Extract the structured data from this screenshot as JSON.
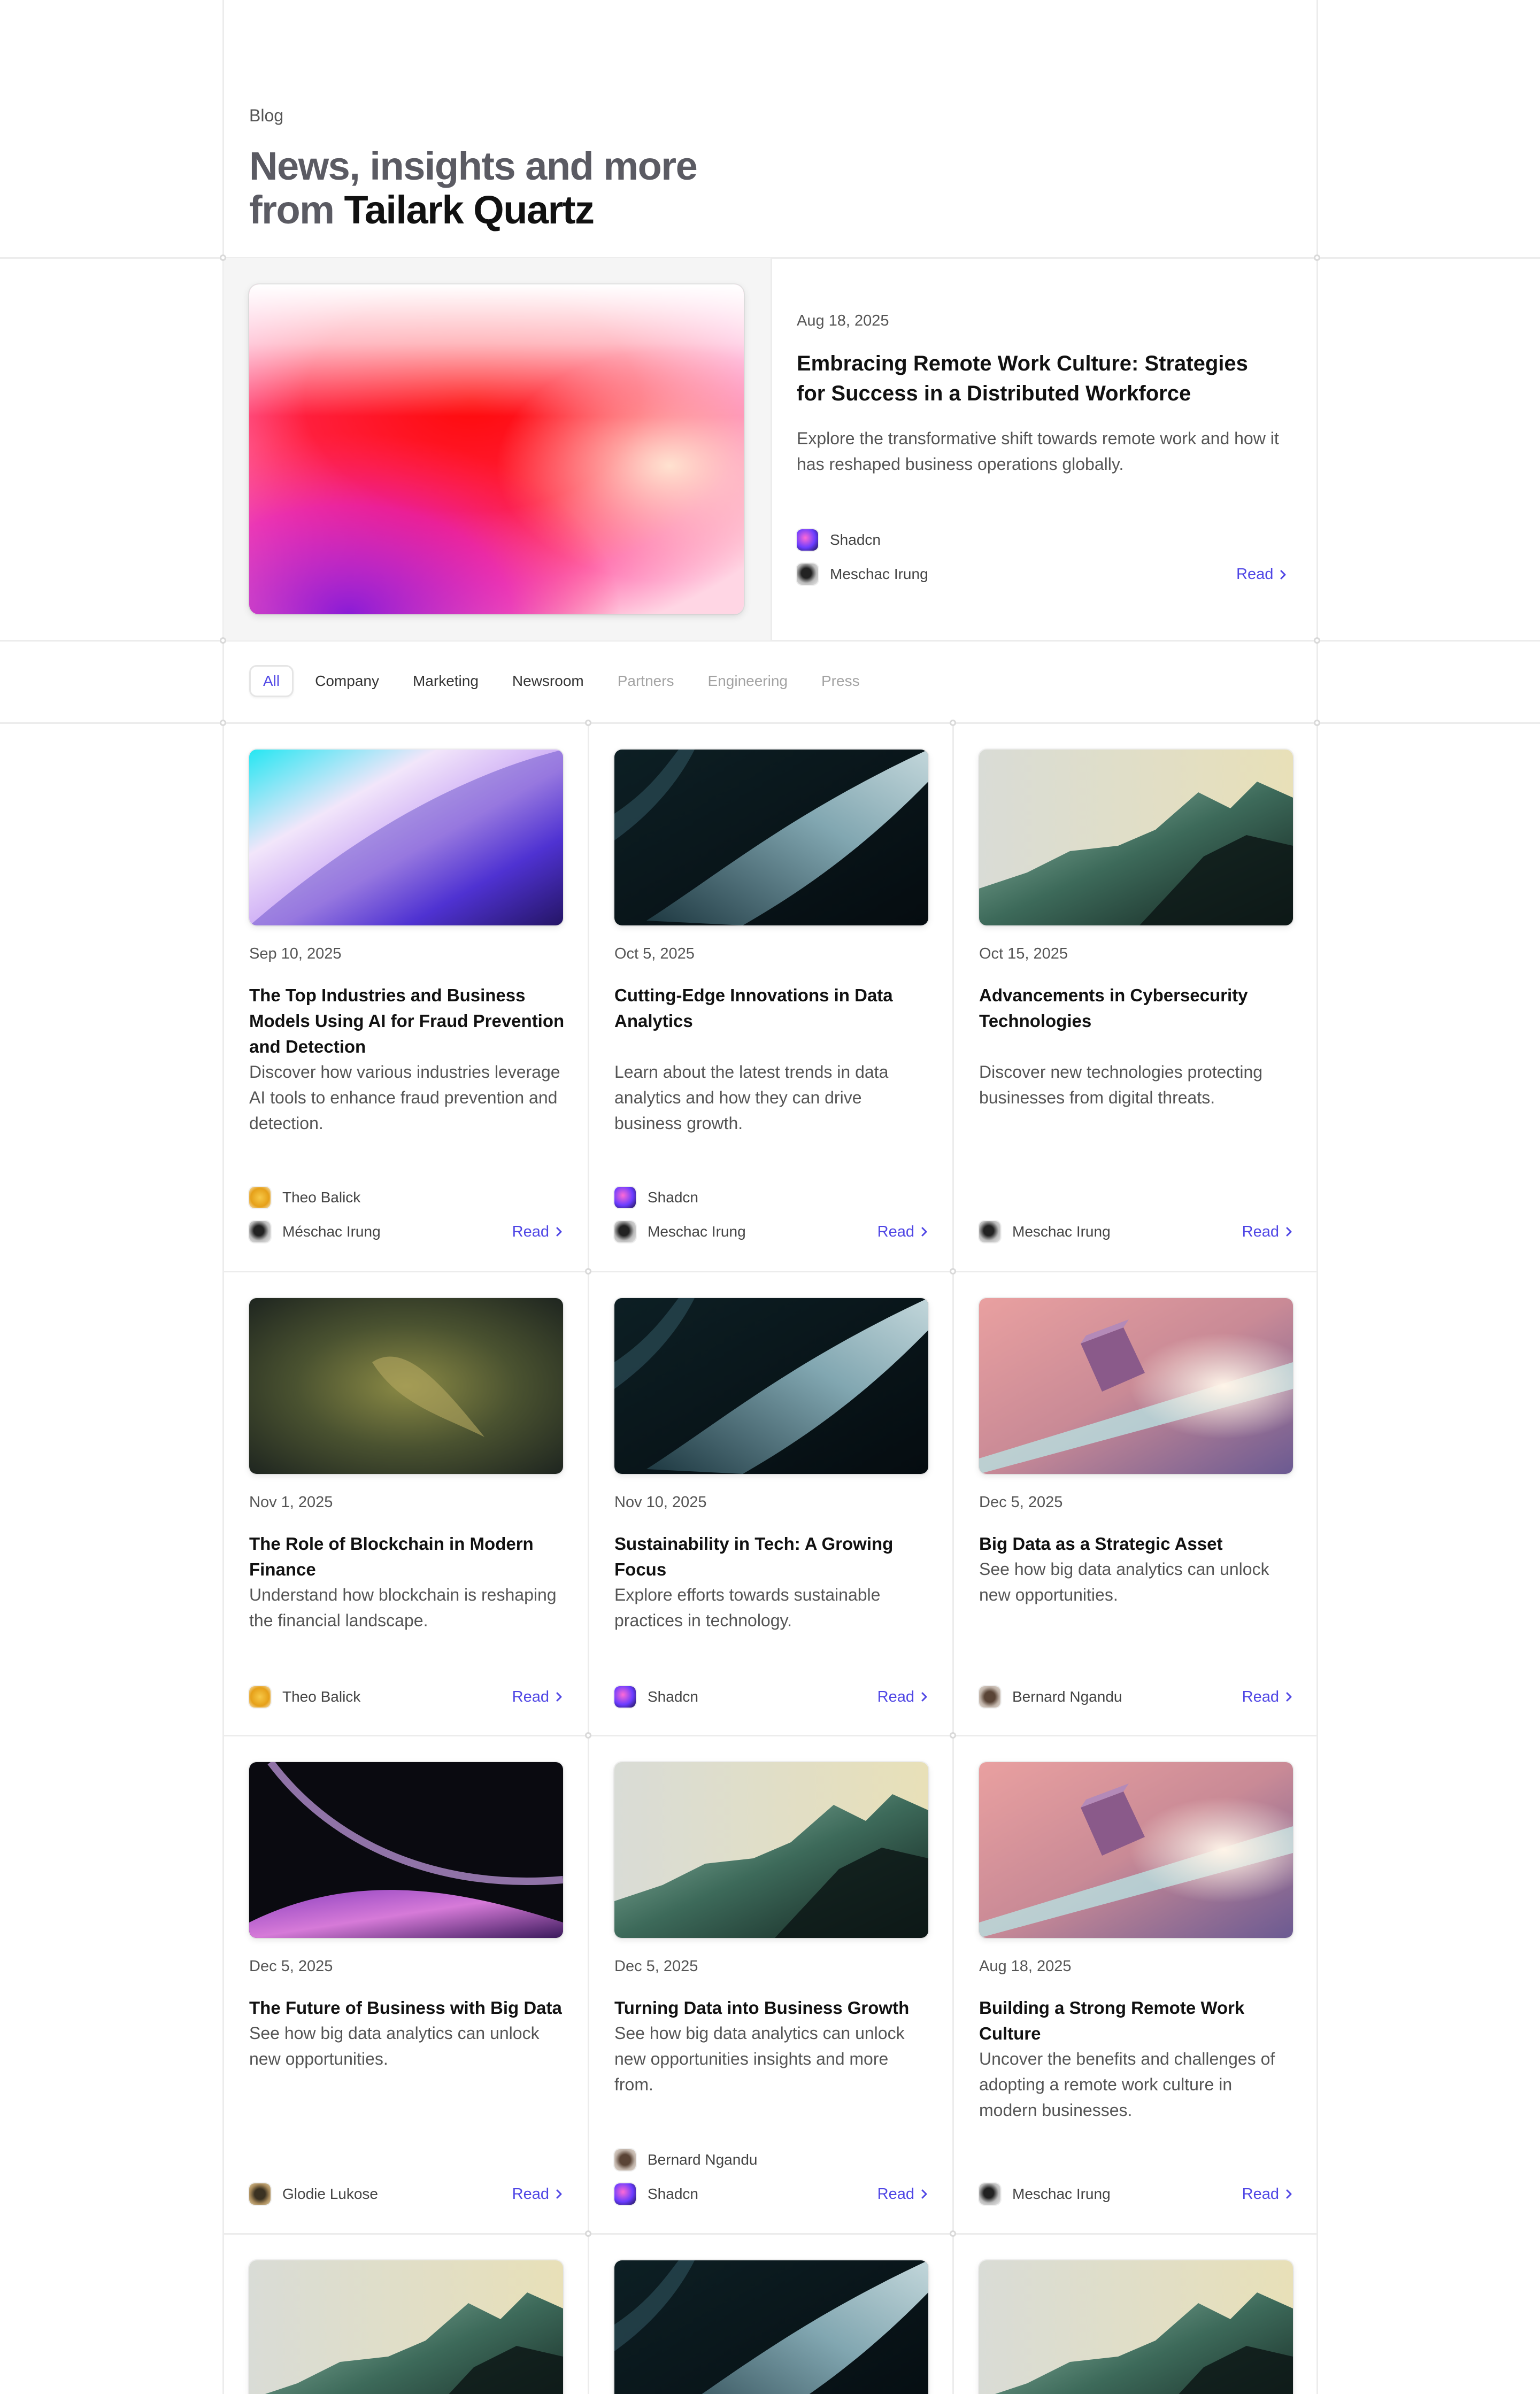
{
  "header": {
    "kicker": "Blog",
    "headline_line1": "News, insights and more",
    "headline_from": "from ",
    "headline_brand": "Tailark Quartz"
  },
  "featured": {
    "date": "Aug 18, 2025",
    "title": "Embracing Remote Work Culture: Strategies for Success in a Distributed Workforce",
    "excerpt": "Explore the transformative shift towards remote work and how it has reshaped business operations globally.",
    "authors": [
      "Shadcn",
      "Meschac Irung"
    ],
    "read_label": "Read"
  },
  "categories": [
    "All",
    "Company",
    "Marketing",
    "Newsroom",
    "Partners",
    "Engineering",
    "Press"
  ],
  "active_category": "All",
  "posts": [
    {
      "date": "Sep 10, 2025",
      "title": "The Top Industries and Business Models Using AI for Fraud Prevention and Detection",
      "excerpt": "Discover how various industries leverage AI tools to enhance fraud prevention and detection.",
      "authors": [
        "Theo Balick",
        "Méschac Irung"
      ],
      "read_label": "Read"
    },
    {
      "date": "Oct 5, 2025",
      "title": "Cutting-Edge Innovations in Data Analytics",
      "excerpt": "Learn about the latest trends in data analytics and how they can drive business growth.",
      "authors": [
        "Shadcn",
        "Meschac Irung"
      ],
      "read_label": "Read"
    },
    {
      "date": "Oct 15, 2025",
      "title": "Advancements in Cybersecurity Technologies",
      "excerpt": "Discover new technologies protecting businesses from digital threats.",
      "authors": [
        "Meschac Irung"
      ],
      "read_label": "Read"
    },
    {
      "date": "Nov 1, 2025",
      "title": "The Role of Blockchain in Modern Finance",
      "excerpt": "Understand how blockchain is reshaping the financial landscape.",
      "authors": [
        "Theo Balick"
      ],
      "read_label": "Read"
    },
    {
      "date": "Nov 10, 2025",
      "title": "Sustainability in Tech: A Growing Focus",
      "excerpt": "Explore efforts towards sustainable practices in technology.",
      "authors": [
        "Shadcn"
      ],
      "read_label": "Read"
    },
    {
      "date": "Dec 5, 2025",
      "title": "Big Data as a Strategic Asset",
      "excerpt": "See how big data analytics can unlock new opportunities.",
      "authors": [
        "Bernard Ngandu"
      ],
      "read_label": "Read"
    },
    {
      "date": "Dec 5, 2025",
      "title": "The Future of Business with Big Data",
      "excerpt": "See how big data analytics can unlock new opportunities.",
      "authors": [
        "Glodie Lukose"
      ],
      "read_label": "Read"
    },
    {
      "date": "Dec 5, 2025",
      "title": "Turning Data into Business Growth",
      "excerpt": "See how big data analytics can unlock new opportunities insights and more from.",
      "authors": [
        "Bernard Ngandu",
        "Shadcn"
      ],
      "read_label": "Read"
    },
    {
      "date": "Aug 18, 2025",
      "title": "Building a Strong Remote Work Culture",
      "excerpt": "Uncover the benefits and challenges of adopting a remote work culture in modern businesses.",
      "authors": [
        "Meschac Irung"
      ],
      "read_label": "Read"
    }
  ],
  "colors": {
    "accent": "#4f46e5",
    "border": "#ececec",
    "muted_text": "#a3a3a3"
  },
  "icons": {
    "read": "chevron-right-icon"
  }
}
